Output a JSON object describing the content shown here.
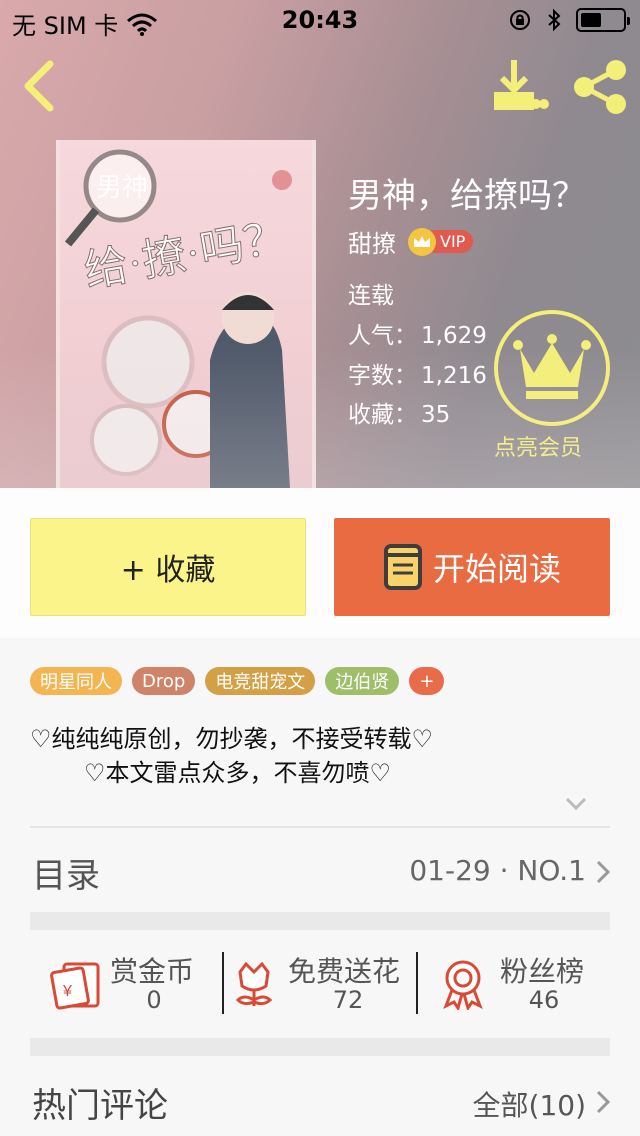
{
  "status_bar": {
    "carrier": "无 SIM 卡",
    "time": "20:43"
  },
  "book": {
    "title": "男神，给撩吗？",
    "author": "甜撩",
    "vip_label": "VIP",
    "status": "连载",
    "popularity_label": "人气：",
    "popularity": "1,629",
    "words_label": "字数：",
    "words": "1,216",
    "favorites_label": "收藏：",
    "favorites": "35",
    "cover_text_main": "给·撩·吗？",
    "cover_text_top": "男神"
  },
  "membership": {
    "label": "点亮会员"
  },
  "actions": {
    "favorite_label": "+ 收藏",
    "read_label": "开始阅读"
  },
  "tags": [
    {
      "label": "明星同人",
      "color": "#f3b552"
    },
    {
      "label": "Drop",
      "color": "#cf8469"
    },
    {
      "label": "电竞甜宠文",
      "color": "#d3a046"
    },
    {
      "label": "边伯贤",
      "color": "#9fbe6a"
    },
    {
      "label": "+",
      "color": "#e86c4a"
    }
  ],
  "description": {
    "line1": "♡纯纯纯原创，勿抄袭，不接受转载♡",
    "line2": "♡本文雷点众多，不喜勿喷♡"
  },
  "toc": {
    "title": "目录",
    "latest": "01-29 · NO.1"
  },
  "stats": {
    "reward_label": "赏金币",
    "reward_value": "0",
    "flower_label": "免费送花",
    "flower_value": "72",
    "fans_label": "粉丝榜",
    "fans_value": "46"
  },
  "comments": {
    "title": "热门评论",
    "all_label": "全部(10)"
  }
}
